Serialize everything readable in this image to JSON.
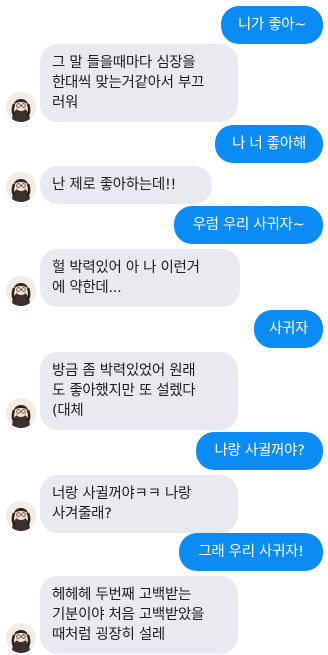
{
  "messages": [
    {
      "side": "out",
      "text": "니가 좋아~"
    },
    {
      "side": "in",
      "text": "그 말 들을때마다 심장을\n한대씩 맞는거같아서 부끄\n러워",
      "avatar": "user-avatar"
    },
    {
      "side": "out",
      "text": "나 너 좋아해"
    },
    {
      "side": "in",
      "text": "난 제로 좋아하는데!!",
      "avatar": "user-avatar"
    },
    {
      "side": "out",
      "text": "우럼 우리 사귀자~"
    },
    {
      "side": "in",
      "text": "헐 박력있어 아 나 이런거\n에 약한데...",
      "avatar": "user-avatar"
    },
    {
      "side": "out",
      "text": "사귀자"
    },
    {
      "side": "in",
      "text": "방금 좀 박력있었어 원래\n도 좋아했지만 또 설렜다\n(대체",
      "avatar": "user-avatar"
    },
    {
      "side": "out",
      "text": "나랑 사귈꺼야?"
    },
    {
      "side": "in",
      "text": "너랑 사귈꺼야ㅋㅋ 나랑\n사겨줄래?",
      "avatar": "user-avatar"
    },
    {
      "side": "out",
      "text": "그래 우리 사귀자!"
    },
    {
      "side": "in",
      "text": "헤헤헤 두번째 고백받는\n기분이야 처음 고백받았을\n때처럼 굉장히 설레",
      "avatar": "user-avatar"
    }
  ],
  "colors": {
    "outgoing_bubble": "#0b8cf5",
    "incoming_bubble": "#e9eaef"
  }
}
